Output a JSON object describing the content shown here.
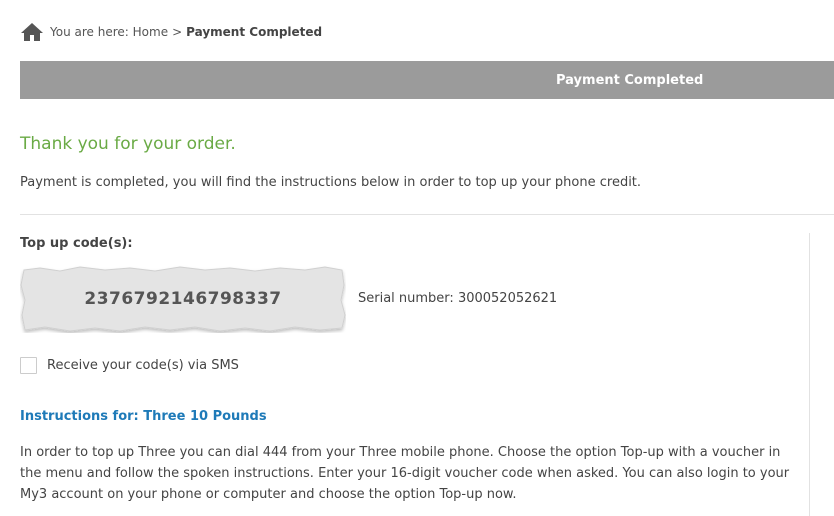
{
  "breadcrumb": {
    "prefix": "You are here:",
    "home": "Home",
    "separator": ">",
    "current": "Payment Completed"
  },
  "banner": {
    "title": "Payment Completed"
  },
  "main": {
    "thanks": "Thank you for your order.",
    "intro": "Payment is completed, you will find the instructions below in order to top up your phone credit.",
    "topup_label": "Top up code(s):",
    "code": "2376792146798337",
    "serial_label": "Serial number:",
    "serial_value": "300052052621",
    "sms_label": "Receive your code(s) via SMS",
    "instructions_title": "Instructions for: Three 10 Pounds",
    "instructions_body": "In order to top up Three you can dial 444 from your Three mobile phone. Choose the option Top-up with a voucher in the menu and follow the spoken instructions. Enter your 16-digit voucher code when asked. You can also login to your My3 account on your phone or computer and choose the option Top-up now."
  },
  "icons": {
    "home": "home-icon"
  },
  "colors": {
    "accent_green": "#6aaa45",
    "link_blue": "#1e7ab8",
    "banner_gray": "#9b9b9b"
  }
}
